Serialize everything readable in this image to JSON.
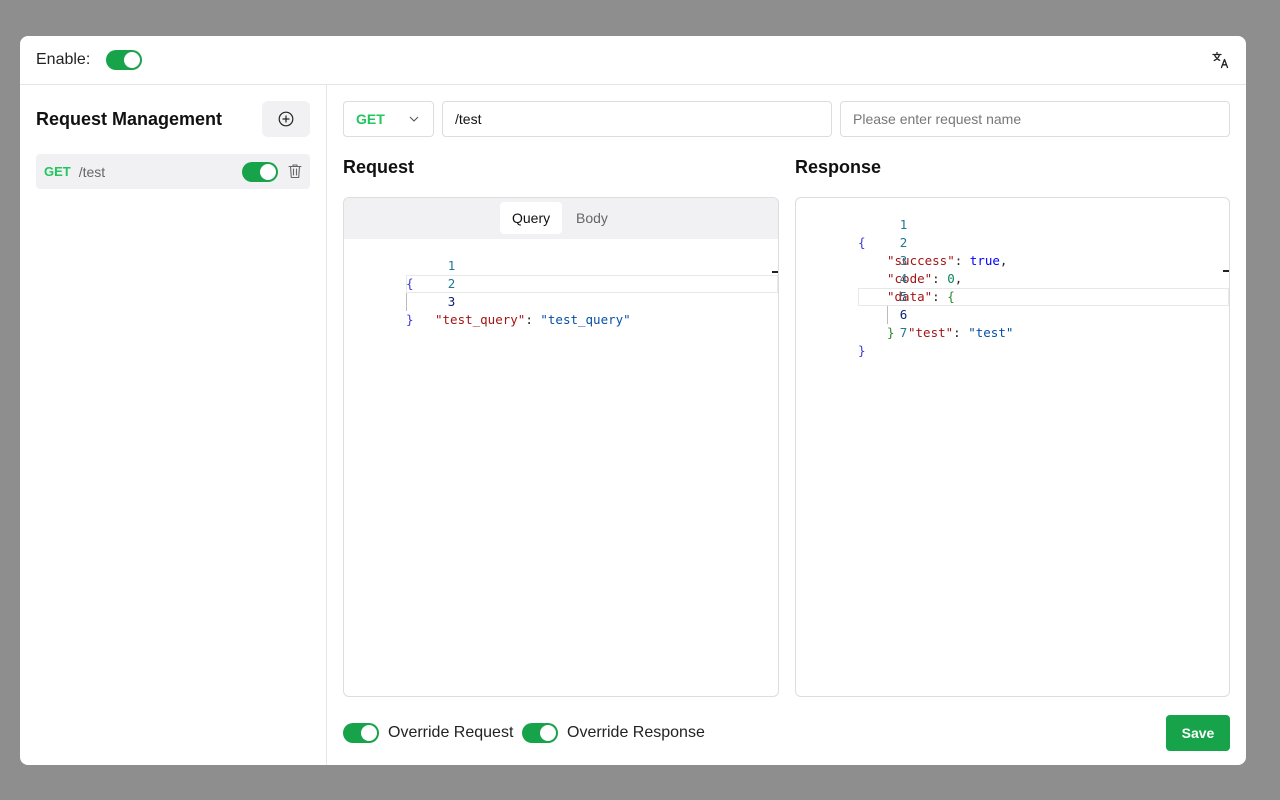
{
  "header": {
    "enable_label": "Enable:",
    "enable_on": true,
    "translate_icon": "translate-icon"
  },
  "sidebar": {
    "title": "Request Management",
    "add_icon": "plus-circle-icon",
    "items": [
      {
        "method": "GET",
        "path": "/test",
        "enabled": true,
        "delete_icon": "trash-icon"
      }
    ]
  },
  "request_bar": {
    "method": "GET",
    "url": "/test",
    "name_placeholder": "Please enter request name"
  },
  "request": {
    "title": "Request",
    "tabs": [
      "Query",
      "Body"
    ],
    "active_tab": "Query",
    "line_numbers": [
      "1",
      "2",
      "3"
    ],
    "code": {
      "open": "{",
      "key": "\"test_query\"",
      "colon": ": ",
      "value": "\"test_query\"",
      "close": "}"
    }
  },
  "response": {
    "title": "Response",
    "line_numbers": [
      "1",
      "2",
      "3",
      "4",
      "5",
      "6",
      "7"
    ],
    "code": {
      "open": "{",
      "success_key": "\"success\"",
      "success_val": "true",
      "code_key": "\"code\"",
      "code_val": "0",
      "data_key": "\"data\"",
      "data_open": "{",
      "test_key": "\"test\"",
      "test_val": "\"test\"",
      "data_close": "}",
      "close": "}",
      "colon": ": ",
      "comma": ","
    }
  },
  "footer": {
    "override_request_label": "Override Request",
    "override_response_label": "Override Response",
    "override_request_on": true,
    "override_response_on": true,
    "save_label": "Save"
  },
  "colors": {
    "accent": "#16a34a",
    "method_get": "#22c55e"
  }
}
